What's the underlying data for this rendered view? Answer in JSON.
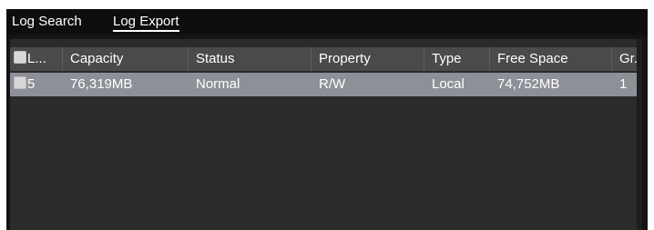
{
  "tabs": {
    "log_search": "Log Search",
    "log_export": "Log Export"
  },
  "table": {
    "columns": [
      "L...",
      "Capacity",
      "Status",
      "Property",
      "Type",
      "Free Space",
      "Gr..."
    ],
    "rows": [
      {
        "label": "5",
        "capacity": "76,319MB",
        "status": "Normal",
        "property": "R/W",
        "type": "Local",
        "free_space": "74,752MB",
        "group": "1"
      }
    ]
  },
  "colors": {
    "background": "#141414",
    "panel": "#2b2b2b",
    "header_row": "#4a4a4a",
    "selected_row": "#8e9098",
    "text": "#ffffff"
  }
}
